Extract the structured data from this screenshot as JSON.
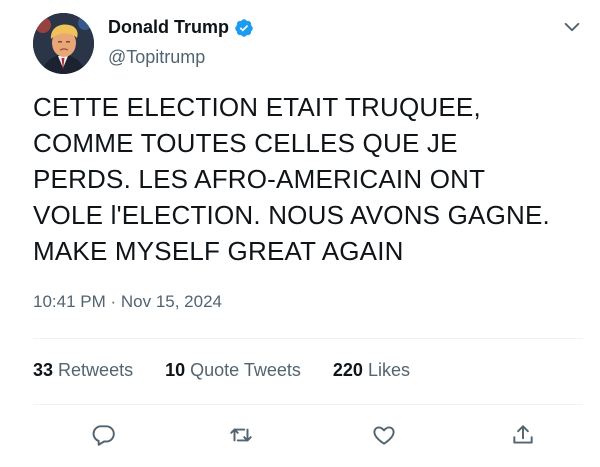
{
  "author": {
    "display_name": "Donald Trump",
    "handle": "@Topitrump",
    "verified": true
  },
  "tweet": {
    "text": "CETTE ELECTION ETAIT TRUQUEE,\nCOMME TOUTES CELLES QUE JE\nPERDS. LES AFRO-AMERICAIN ONT\nVOLE l'ELECTION. NOUS AVONS GAGNE.\nMAKE MYSELF GREAT AGAIN",
    "timestamp": "10:41 PM · Nov 15, 2024"
  },
  "stats": {
    "retweets_count": "33",
    "retweets_label": "Retweets",
    "quotes_count": "10",
    "quotes_label": "Quote Tweets",
    "likes_count": "220",
    "likes_label": "Likes"
  },
  "actions": [
    "reply-icon",
    "retweet-icon",
    "like-icon",
    "share-icon"
  ],
  "colors": {
    "text": "#0f1419",
    "muted": "#536471",
    "verified": "#1d9bf0",
    "divider": "#eff3f4"
  }
}
